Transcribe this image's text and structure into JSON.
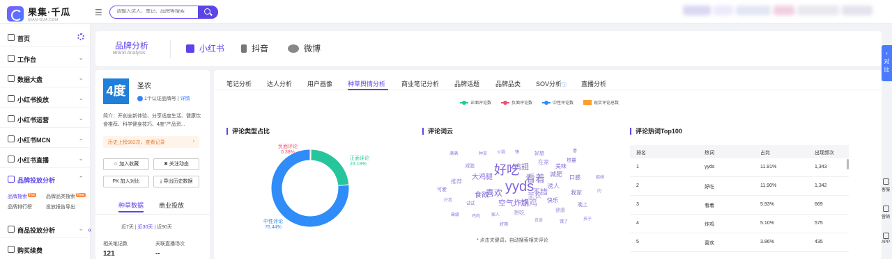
{
  "header": {
    "logo_title": "果集·千瓜",
    "logo_sub": "QIAN-GUA.COM",
    "search_placeholder": "请输入达人、笔记、品牌等搜索"
  },
  "sidebar": {
    "items": [
      {
        "label": "首页"
      },
      {
        "label": "工作台"
      },
      {
        "label": "数据大盘"
      },
      {
        "label": "小红书投放"
      },
      {
        "label": "小红书运营"
      },
      {
        "label": "小红书MCN"
      },
      {
        "label": "小红书直播"
      },
      {
        "label": "品牌投放分析"
      },
      {
        "label": "商品投放分析"
      },
      {
        "label": "购买续费"
      }
    ],
    "sub_links": [
      "品牌搜索",
      "品牌品类搜索",
      "品牌排行榜",
      "投放报告导出"
    ],
    "hot_badge": "Hot",
    "new_badge": "New"
  },
  "brand_header": {
    "title": "品牌分析",
    "subtitle": "Brand Analysis",
    "platforms": [
      "小红书",
      "抖音",
      "微博"
    ]
  },
  "brand_info": {
    "logo_text": "4度",
    "name": "圣农",
    "verify_text": "1个认证品牌号",
    "verify_link": "详情",
    "intro": "简介：开创全新体验、分享适度生活、健康饮食推荐、科学健身技巧、4度°产品资...",
    "history": "历史上榜982次，查看记录",
    "buttons": [
      "加入收藏",
      "关注动态",
      "加入对比",
      "导出历史数据"
    ],
    "sub_tabs": [
      "种草数据",
      "商业投放"
    ],
    "periods": [
      "近7天",
      "近30天",
      "近90天"
    ],
    "stat_labels": [
      "相关笔记数",
      "关联直播场次"
    ],
    "stat_values": [
      "121",
      "--"
    ]
  },
  "main": {
    "tabs": [
      "笔记分析",
      "达人分析",
      "用户画像",
      "种草舆情分析",
      "商业笔记分析",
      "品牌话题",
      "品牌品类",
      "SOV分析",
      "直播分析"
    ],
    "legend": [
      "正面评论数",
      "负面评论数",
      "中性评论数",
      "现实评论总数"
    ],
    "section_titles": [
      "评论类型占比",
      "评论词云",
      "评论热词Top100"
    ],
    "cloud_note": "* 点击关键词，自动搜索相关评论",
    "table_headers": [
      "排名",
      "热词",
      "占比",
      "出现频次"
    ],
    "table_rows": [
      [
        "1",
        "yyds",
        "11.91%",
        "1,343"
      ],
      [
        "2",
        "好吃",
        "11.90%",
        "1,342"
      ],
      [
        "3",
        "看着",
        "5.93%",
        "669"
      ],
      [
        "4",
        "炸鸡",
        "5.10%",
        "575"
      ],
      [
        "5",
        "喜欢",
        "3.86%",
        "435"
      ]
    ]
  },
  "chart_data": {
    "type": "pie",
    "title": "评论类型占比",
    "slices": [
      {
        "label": "负面评论",
        "value": 0.38,
        "color": "#f0506e"
      },
      {
        "label": "正面评论",
        "value": 23.18,
        "color": "#27c59b"
      },
      {
        "label": "中性评论",
        "value": 76.44,
        "color": "#2f8cf8"
      }
    ],
    "display_labels": [
      "0.38%",
      "23.18%",
      "76.44%"
    ]
  },
  "word_cloud": [
    "yyds",
    "好吃",
    "看着",
    "炸鸡",
    "喜欢",
    "空气炸锅",
    "不错",
    "鸡翅",
    "圣农",
    "食欲",
    "大鸡腿",
    "诱人",
    "减肥",
    "推荐",
    "口感",
    "美味",
    "在家",
    "我家",
    "想吃",
    "快乐",
    "好想",
    "减脂",
    "晚上",
    "健康",
    "热量",
    "可爱",
    "种草",
    "家人",
    "好看",
    "试试",
    "香",
    "鸡肉",
    "姐妹",
    "肉",
    "馋",
    "高级",
    "火锅",
    "饿了",
    "真香",
    "好用",
    "满满",
    "孩子"
  ],
  "rail": {
    "float_text": "对比",
    "items": [
      "客服",
      "营销",
      "APP"
    ]
  }
}
